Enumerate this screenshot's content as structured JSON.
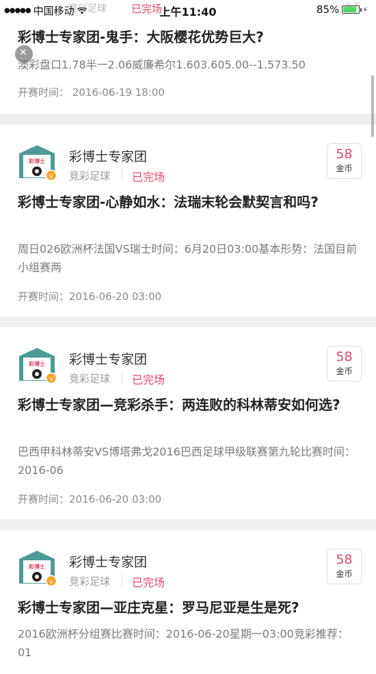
{
  "statusbar": {
    "carrier": "中国移动",
    "time": "上午11:40",
    "battery": "85%",
    "battery_level": 0.85
  },
  "ghost": {
    "category": "竞彩足球",
    "status": "已完场",
    "coin": "金币"
  },
  "first_card": {
    "title": "彩博士专家团-鬼手：大阪樱花优势巨大?",
    "summary": "澳彩盘口1.78半一2.06威廉希尔1.603.605.00--1.573.50",
    "time_label": "开赛时间：",
    "time_value": "2016-06-19 18:00"
  },
  "cards": [
    {
      "author": "彩博士专家团",
      "category": "竞彩足球",
      "status": "已完场",
      "price": "58",
      "price_unit": "金币",
      "title": "彩博士专家团-心静如水：法瑞末轮会默契言和吗?",
      "summary": "周日026欧洲杯法国VS瑞士时间：6月20日03:00基本形势：法国目前小组赛两",
      "time_label": "开赛时间：",
      "time_value": "2016-06-20 03:00"
    },
    {
      "author": "彩博士专家团",
      "category": "竞彩足球",
      "status": "已完场",
      "price": "58",
      "price_unit": "金币",
      "title": "彩博士专家团—竞彩杀手：两连败的科林蒂安如何选?",
      "summary": "巴西甲科林蒂安VS博塔弗戈2016巴西足球甲级联赛第九轮比赛时间：2016-06",
      "time_label": "开赛时间：",
      "time_value": "2016-06-20 03:00"
    },
    {
      "author": "彩博士专家团",
      "category": "竞彩足球",
      "status": "已完场",
      "price": "58",
      "price_unit": "金币",
      "title": "彩博士专家团—亚庄克星：罗马尼亚是生是死?",
      "summary": "2016欧洲杯分组赛比赛时间：2016-06-20星期一03:00竞彩推荐：01"
    }
  ],
  "colors": {
    "accent": "#e0476b",
    "background": "#efefef",
    "avatar_teal": "#4e9a95",
    "badge": "#f5a623"
  },
  "icons": [
    "wifi-icon",
    "battery-icon",
    "avatar-icon",
    "verified-badge-icon",
    "close-icon"
  ]
}
